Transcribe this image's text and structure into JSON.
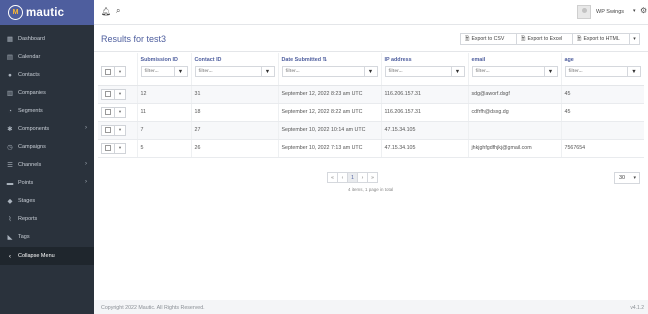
{
  "brand": {
    "name": "mautic"
  },
  "sidebar": {
    "items": [
      {
        "label": "Dashboard",
        "icon": "dashboard-icon",
        "glyph": "▦",
        "arrow": false
      },
      {
        "label": "Calendar",
        "icon": "calendar-icon",
        "glyph": "▤",
        "arrow": false
      },
      {
        "label": "Contacts",
        "icon": "user-icon",
        "glyph": "●",
        "arrow": false
      },
      {
        "label": "Companies",
        "icon": "building-icon",
        "glyph": "▥",
        "arrow": false
      },
      {
        "label": "Segments",
        "icon": "pie-chart-icon",
        "glyph": "◔",
        "arrow": false
      },
      {
        "label": "Components",
        "icon": "puzzle-icon",
        "glyph": "✱",
        "arrow": true
      },
      {
        "label": "Campaigns",
        "icon": "clock-icon",
        "glyph": "◷",
        "arrow": false
      },
      {
        "label": "Channels",
        "icon": "rss-icon",
        "glyph": "☰",
        "arrow": true
      },
      {
        "label": "Points",
        "icon": "points-icon",
        "glyph": "▬",
        "arrow": true
      },
      {
        "label": "Stages",
        "icon": "stages-icon",
        "glyph": "◆",
        "arrow": false
      },
      {
        "label": "Reports",
        "icon": "line-chart-icon",
        "glyph": "⌇",
        "arrow": false
      },
      {
        "label": "Tags",
        "icon": "tag-icon",
        "glyph": "◣",
        "arrow": false
      }
    ],
    "collapse_label": "Collapse Menu"
  },
  "topbar": {
    "user_name": "WP Swings"
  },
  "page": {
    "title": "Results for test3",
    "buttons": [
      {
        "label": "Export to CSV",
        "icon": "file-icon"
      },
      {
        "label": "Export to Excel",
        "icon": "file-icon"
      },
      {
        "label": "Export to HTML",
        "icon": "file-icon"
      }
    ]
  },
  "table": {
    "columns": [
      "Submission ID",
      "Contact ID",
      "Date Submitted",
      "IP address",
      "email",
      "age"
    ],
    "filter_placeholder": "filter...",
    "rows": [
      [
        "12",
        "31",
        "September 12, 2022 8:23 am UTC",
        "116.206.157.31",
        "sdg@aworf.dsgf",
        "45"
      ],
      [
        "11",
        "18",
        "September 12, 2022 8:22 am UTC",
        "116.206.157.31",
        "cdfrfh@dsxg.dg",
        "45"
      ],
      [
        "7",
        "27",
        "September 10, 2022 10:14 am UTC",
        "47.15.34.105",
        "",
        ""
      ],
      [
        "5",
        "26",
        "September 10, 2022 7:13 am UTC",
        "47.15.34.105",
        "jhkjghfgdfhjkj@gmail.com",
        "7567654"
      ]
    ]
  },
  "pagination": {
    "first": "«",
    "prev": "‹",
    "current": "1",
    "next": "›",
    "last": "»",
    "info": "4 items, 1 page in total",
    "per_page": "30"
  },
  "footer": {
    "copyright": "Copyright 2022 Mautic. All Rights Reserved.",
    "version": "v4.1.2"
  },
  "colors": {
    "brand": "#4e5e9e",
    "sidebar": "#2a323c",
    "accent": "#fdb933"
  }
}
